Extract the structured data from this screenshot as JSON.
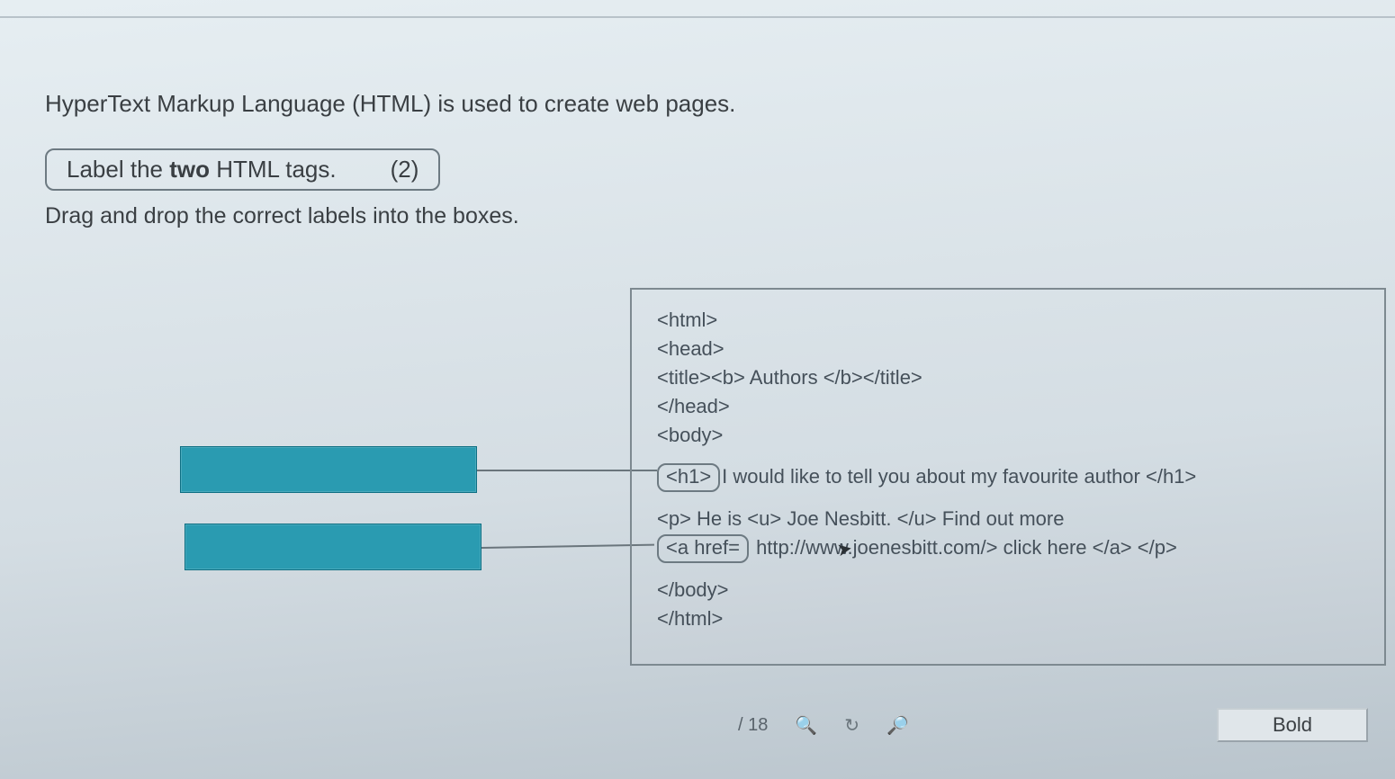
{
  "intro_text": "HyperText Markup Language (HTML) is used to create web pages.",
  "instruction": {
    "prefix": "Label the ",
    "bold_word": "two",
    "suffix": " HTML tags.",
    "marks": "(2)"
  },
  "sub_instruction": "Drag and drop the correct labels into the boxes.",
  "code": {
    "l1": "<html>",
    "l2": "<head>",
    "l3": "<title><b> Authors </b></title>",
    "l4": "</head>",
    "l5": "<body>",
    "boxed1": "<h1>",
    "after_boxed1": "I would like to tell you about my favourite author </h1>",
    "l7": "<p> He is <u> Joe Nesbitt. </u> Find out more",
    "boxed2": "<a href=",
    "after_boxed2": " http://www.joenesbitt.com/> click here </a> </p>",
    "l9": "</body>",
    "l10": "</html>"
  },
  "toolbar": {
    "page_count": "/ 18",
    "bold_label": "Bold"
  }
}
